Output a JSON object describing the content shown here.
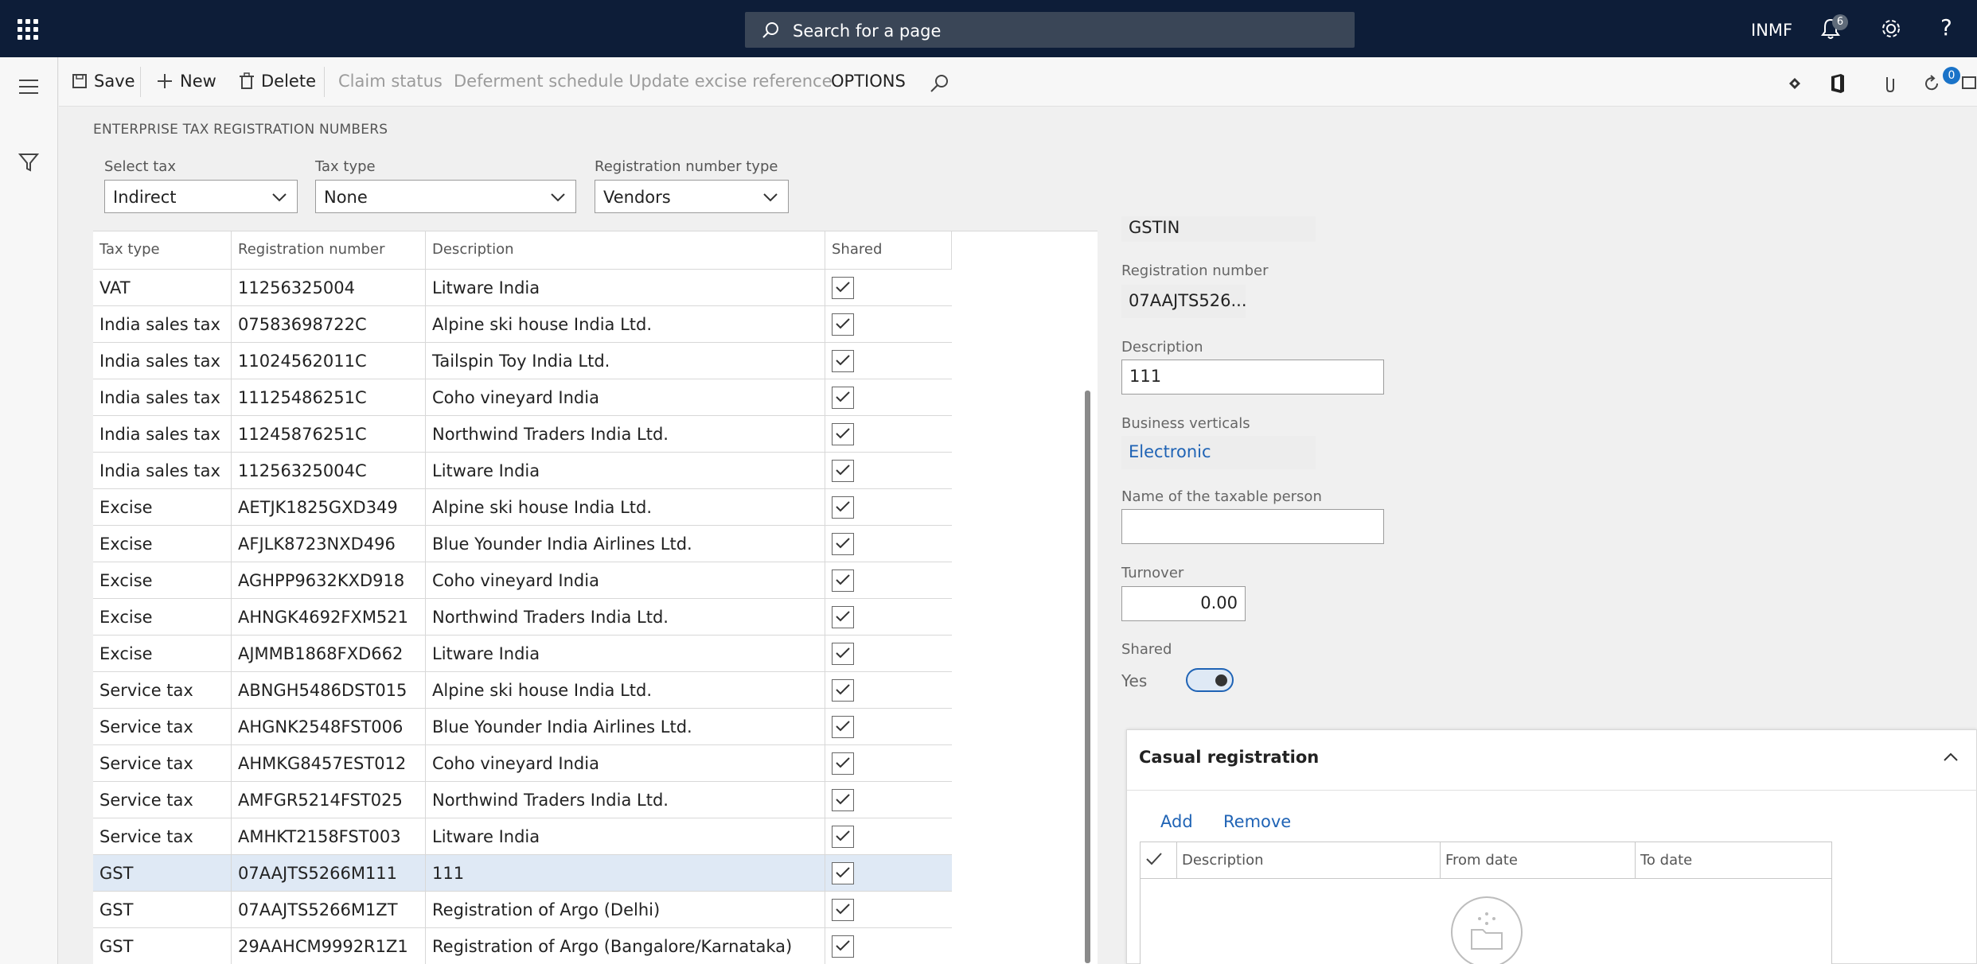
{
  "topbar": {
    "search_placeholder": "Search for a page",
    "company": "INMF",
    "notification_count": "6"
  },
  "actions": {
    "save": "Save",
    "new": "New",
    "delete": "Delete",
    "claim_status": "Claim status",
    "deferment_schedule": "Deferment schedule",
    "update_excise_reference": "Update excise reference",
    "options": "OPTIONS",
    "attachments_count": "0"
  },
  "page": {
    "section_title": "ENTERPRISE TAX REGISTRATION NUMBERS",
    "filters": {
      "select_tax_label": "Select tax",
      "select_tax_value": "Indirect",
      "tax_type_label": "Tax type",
      "tax_type_value": "None",
      "reg_number_type_label": "Registration number type",
      "reg_number_type_value": "Vendors"
    }
  },
  "grid": {
    "columns": [
      "Tax type",
      "Registration number",
      "Description",
      "Shared"
    ],
    "rows": [
      {
        "tax_type": "VAT",
        "reg": "11256325004",
        "desc": "Litware India",
        "shared": true
      },
      {
        "tax_type": "India sales tax",
        "reg": "07583698722C",
        "desc": "Alpine ski house India Ltd.",
        "shared": true
      },
      {
        "tax_type": "India sales tax",
        "reg": "11024562011C",
        "desc": "Tailspin Toy India Ltd.",
        "shared": true
      },
      {
        "tax_type": "India sales tax",
        "reg": "11125486251C",
        "desc": "Coho vineyard India",
        "shared": true
      },
      {
        "tax_type": "India sales tax",
        "reg": "11245876251C",
        "desc": "Northwind Traders India Ltd.",
        "shared": true
      },
      {
        "tax_type": "India sales tax",
        "reg": "11256325004C",
        "desc": "Litware India",
        "shared": true
      },
      {
        "tax_type": "Excise",
        "reg": "AETJK1825GXD349",
        "desc": "Alpine ski house India Ltd.",
        "shared": true
      },
      {
        "tax_type": "Excise",
        "reg": "AFJLK8723NXD496",
        "desc": "Blue Younder India Airlines Ltd.",
        "shared": true
      },
      {
        "tax_type": "Excise",
        "reg": "AGHPP9632KXD918",
        "desc": "Coho vineyard India",
        "shared": true
      },
      {
        "tax_type": "Excise",
        "reg": "AHNGK4692FXM521",
        "desc": "Northwind Traders India Ltd.",
        "shared": true
      },
      {
        "tax_type": "Excise",
        "reg": "AJMMB1868FXD662",
        "desc": "Litware India",
        "shared": true
      },
      {
        "tax_type": "Service tax",
        "reg": "ABNGH5486DST015",
        "desc": "Alpine ski house India Ltd.",
        "shared": true
      },
      {
        "tax_type": "Service tax",
        "reg": "AHGNK2548FST006",
        "desc": "Blue Younder India Airlines Ltd.",
        "shared": true
      },
      {
        "tax_type": "Service tax",
        "reg": "AHMKG8457EST012",
        "desc": "Coho vineyard India",
        "shared": true
      },
      {
        "tax_type": "Service tax",
        "reg": "AMFGR5214FST025",
        "desc": "Northwind Traders India Ltd.",
        "shared": true
      },
      {
        "tax_type": "Service tax",
        "reg": "AMHKT2158FST003",
        "desc": "Litware India",
        "shared": true
      },
      {
        "tax_type": "GST",
        "reg": "07AAJTS5266M111",
        "desc": "111",
        "shared": true,
        "selected": true
      },
      {
        "tax_type": "GST",
        "reg": "07AAJTS5266M1ZT",
        "desc": "Registration of Argo (Delhi)",
        "shared": true
      },
      {
        "tax_type": "GST",
        "reg": "29AAHCM9992R1Z1",
        "desc": "Registration of Argo (Bangalore/Karnataka)",
        "shared": true
      }
    ]
  },
  "details": {
    "reg_type_value": "GSTIN",
    "reg_number_label": "Registration number",
    "reg_number_value": "07AAJTS526...",
    "description_label": "Description",
    "description_value": "111",
    "business_verticals_label": "Business verticals",
    "business_verticals_value": "Electronic",
    "taxable_person_label": "Name of the taxable person",
    "taxable_person_value": "",
    "turnover_label": "Turnover",
    "turnover_value": "0.00",
    "shared_label": "Shared",
    "shared_value": "Yes"
  },
  "casual_registration": {
    "title": "Casual registration",
    "add": "Add",
    "remove": "Remove",
    "columns": [
      "Description",
      "From date",
      "To date"
    ]
  },
  "colors": {
    "nav_bg": "#0d1d38",
    "accent": "#1f63b5",
    "selected_row": "#dfe9f5"
  }
}
